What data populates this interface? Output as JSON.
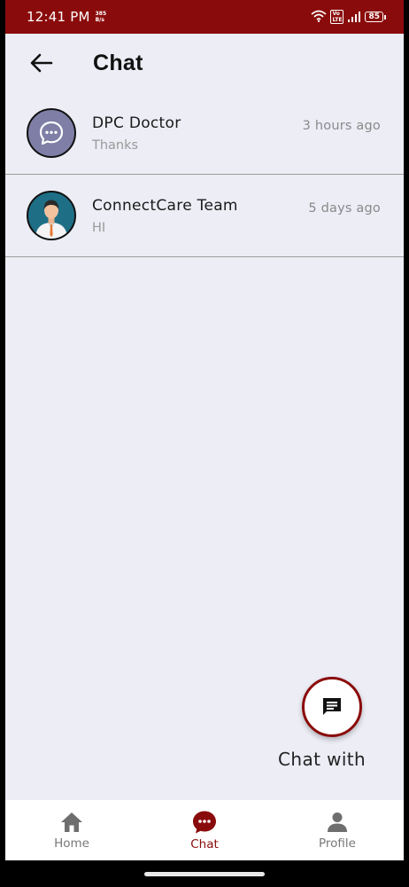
{
  "status_bar": {
    "time": "12:41 PM",
    "speed_value": "385",
    "speed_unit": "B/s",
    "volte_top": "Vo",
    "volte_bottom": "LTE",
    "battery": "85"
  },
  "header": {
    "title": "Chat"
  },
  "chats": [
    {
      "name": "DPC Doctor",
      "preview": "Thanks",
      "time": "3 hours ago",
      "avatar_icon": "chat-bubble-icon"
    },
    {
      "name": "ConnectCare Team",
      "preview": "HI",
      "time": "5 days ago",
      "avatar_icon": "doctor-avatar-icon"
    }
  ],
  "fab": {
    "label": "Chat with",
    "icon": "message-icon"
  },
  "bottom_nav": [
    {
      "label": "Home",
      "icon": "home-icon",
      "active": false
    },
    {
      "label": "Chat",
      "icon": "chat-icon",
      "active": true
    },
    {
      "label": "Profile",
      "icon": "person-icon",
      "active": false
    }
  ],
  "colors": {
    "primary": "#8a0b0b",
    "background": "#ecedf5",
    "avatar_purple": "#7e7ea6",
    "avatar_teal": "#1e6e86"
  }
}
